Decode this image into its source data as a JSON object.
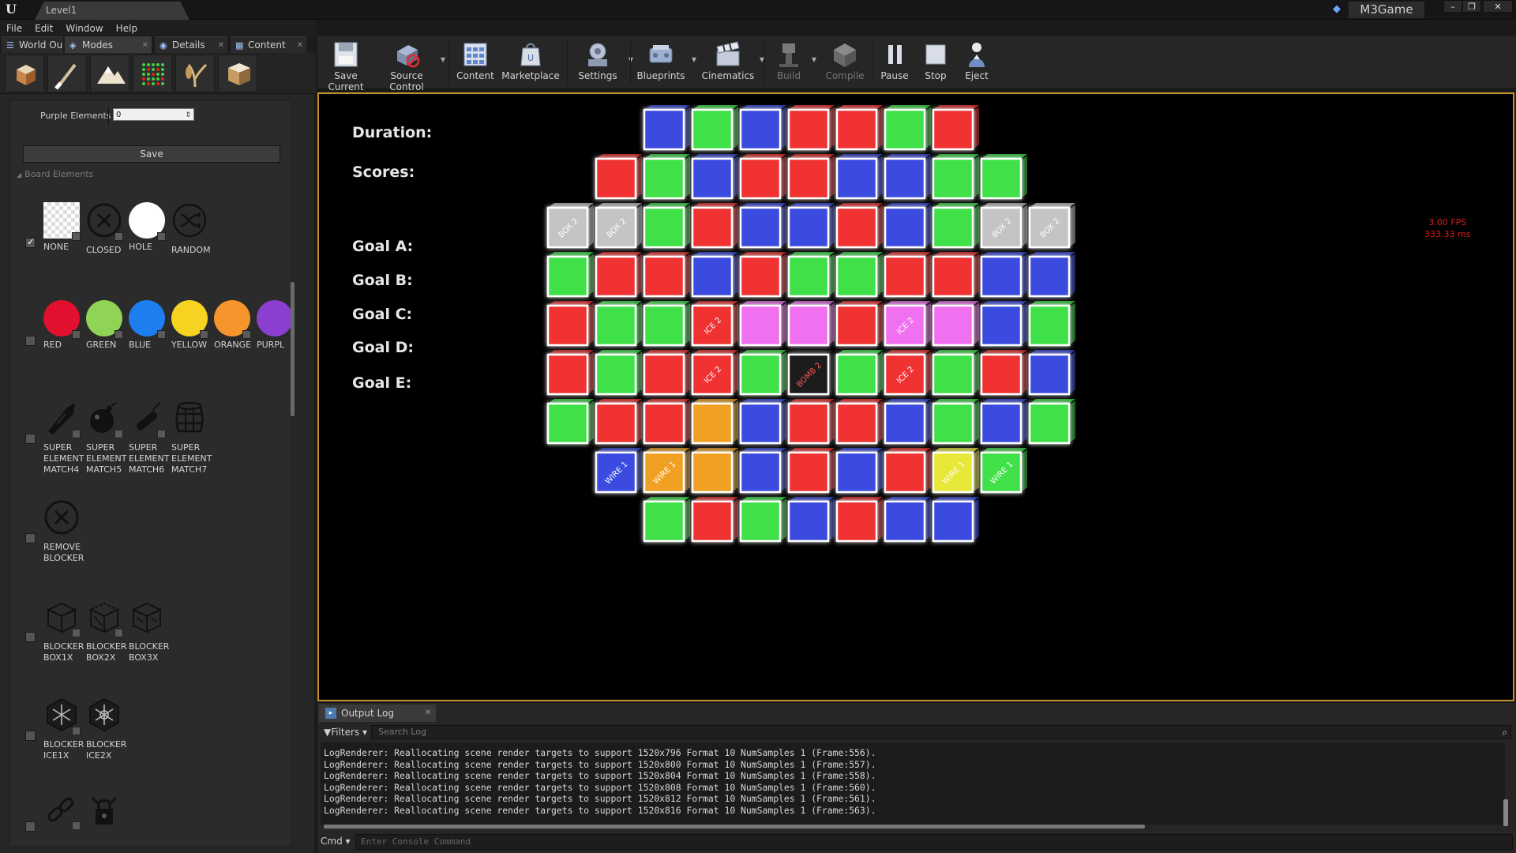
{
  "window": {
    "level_tab": "Level1",
    "app_name": "M3Game"
  },
  "menu": [
    "File",
    "Edit",
    "Window",
    "Help"
  ],
  "panel_tabs": [
    {
      "label": "World Ou"
    },
    {
      "label": "Modes"
    },
    {
      "label": "Details"
    },
    {
      "label": "Content"
    }
  ],
  "mode_tools": [
    "place-icon",
    "paint-icon",
    "landscape-icon",
    "foliage-icon",
    "mesh-paint-icon",
    "geometry-icon"
  ],
  "panel": {
    "purple_label": "Purple Elements",
    "purple_value": "0",
    "save_label": "Save",
    "section_title": "Board Elements",
    "row1": [
      {
        "label": "NONE"
      },
      {
        "label": "CLOSED"
      },
      {
        "label": "HOLE"
      },
      {
        "label": "RANDOM"
      }
    ],
    "row2": [
      {
        "label": "RED",
        "color": "#e0102e"
      },
      {
        "label": "GREEN",
        "color": "#8fd455"
      },
      {
        "label": "BLUE",
        "color": "#1e7ef0"
      },
      {
        "label": "YELLOW",
        "color": "#f5d320"
      },
      {
        "label": "ORANGE",
        "color": "#f5952c"
      },
      {
        "label": "PURPL",
        "color": "#8a3fd0"
      }
    ],
    "row3": [
      {
        "label": "SUPER ELEMENT MATCH4"
      },
      {
        "label": "SUPER ELEMENT MATCH5"
      },
      {
        "label": "SUPER ELEMENT MATCH6"
      },
      {
        "label": "SUPER ELEMENT MATCH7"
      }
    ],
    "row4": [
      {
        "label": "REMOVE BLOCKER"
      }
    ],
    "row5": [
      {
        "label": "BLOCKER BOX1X"
      },
      {
        "label": "BLOCKER BOX2X"
      },
      {
        "label": "BLOCKER BOX3X"
      }
    ],
    "row6": [
      {
        "label": "BLOCKER ICE1X"
      },
      {
        "label": "BLOCKER ICE2X"
      }
    ]
  },
  "toolbar": [
    {
      "label": "Save Current",
      "icon": "save-icon"
    },
    {
      "label": "Source Control",
      "icon": "source-control-icon"
    },
    {
      "label": "Content",
      "icon": "content-icon"
    },
    {
      "label": "Marketplace",
      "icon": "marketplace-icon"
    },
    {
      "label": "Settings",
      "icon": "settings-icon"
    },
    {
      "label": "Blueprints",
      "icon": "blueprints-icon"
    },
    {
      "label": "Cinematics",
      "icon": "cinematics-icon"
    },
    {
      "label": "Build",
      "icon": "build-icon"
    },
    {
      "label": "Compile",
      "icon": "compile-icon"
    },
    {
      "label": "Pause",
      "icon": "pause-icon"
    },
    {
      "label": "Stop",
      "icon": "stop-icon"
    },
    {
      "label": "Eject",
      "icon": "eject-icon"
    }
  ],
  "hud": {
    "duration": "Duration:",
    "scores": "Scores:",
    "goal_a": "Goal A:",
    "goal_b": "Goal B:",
    "goal_c": "Goal C:",
    "goal_d": "Goal D:",
    "goal_e": "Goal E:",
    "fps": "3.00 FPS",
    "ms": "333.33 ms"
  },
  "colors": {
    "R": "#f03232",
    "G": "#3fe04a",
    "B": "#3a4be0",
    "P": "#f070f0",
    "O": "#f0a020",
    "Y": "#e8e838",
    "X": "#c4c4c4",
    "K": "#1a1a1a"
  },
  "board": {
    "row_starts": [
      2,
      1,
      0,
      0,
      0,
      0,
      0,
      1,
      2
    ],
    "rows": [
      [
        {
          "c": "B"
        },
        {
          "c": "G"
        },
        {
          "c": "B"
        },
        {
          "c": "R"
        },
        {
          "c": "R"
        },
        {
          "c": "G"
        },
        {
          "c": "R"
        }
      ],
      [
        {
          "c": "R"
        },
        {
          "c": "G"
        },
        {
          "c": "B"
        },
        {
          "c": "R"
        },
        {
          "c": "R"
        },
        {
          "c": "B"
        },
        {
          "c": "B"
        },
        {
          "c": "G"
        },
        {
          "c": "G"
        }
      ],
      [
        {
          "c": "X",
          "t": "BOX 2"
        },
        {
          "c": "X",
          "t": "BOX 2"
        },
        {
          "c": "G"
        },
        {
          "c": "R"
        },
        {
          "c": "B"
        },
        {
          "c": "B"
        },
        {
          "c": "R"
        },
        {
          "c": "B"
        },
        {
          "c": "G"
        },
        {
          "c": "X",
          "t": "BOX 2"
        },
        {
          "c": "X",
          "t": "BOX 2"
        }
      ],
      [
        {
          "c": "G"
        },
        {
          "c": "R"
        },
        {
          "c": "R"
        },
        {
          "c": "B"
        },
        {
          "c": "R"
        },
        {
          "c": "G"
        },
        {
          "c": "G"
        },
        {
          "c": "R"
        },
        {
          "c": "R"
        },
        {
          "c": "B"
        },
        {
          "c": "B"
        }
      ],
      [
        {
          "c": "R"
        },
        {
          "c": "G"
        },
        {
          "c": "G"
        },
        {
          "c": "R",
          "t": "ICE 2"
        },
        {
          "c": "P"
        },
        {
          "c": "P"
        },
        {
          "c": "R"
        },
        {
          "c": "P",
          "t": "ICE 2"
        },
        {
          "c": "P"
        },
        {
          "c": "B"
        },
        {
          "c": "G"
        }
      ],
      [
        {
          "c": "R"
        },
        {
          "c": "G"
        },
        {
          "c": "R"
        },
        {
          "c": "R",
          "t": "ICE 2"
        },
        {
          "c": "G"
        },
        {
          "c": "K",
          "t": "BOMB 2"
        },
        {
          "c": "G"
        },
        {
          "c": "R",
          "t": "ICE 2"
        },
        {
          "c": "G"
        },
        {
          "c": "R"
        },
        {
          "c": "B"
        }
      ],
      [
        {
          "c": "G"
        },
        {
          "c": "R"
        },
        {
          "c": "R"
        },
        {
          "c": "O"
        },
        {
          "c": "B"
        },
        {
          "c": "R"
        },
        {
          "c": "R"
        },
        {
          "c": "B"
        },
        {
          "c": "G"
        },
        {
          "c": "B"
        },
        {
          "c": "G"
        }
      ],
      [
        {
          "c": "B",
          "t": "WIRE 1"
        },
        {
          "c": "O",
          "t": "WIRE 1"
        },
        {
          "c": "O"
        },
        {
          "c": "B"
        },
        {
          "c": "R"
        },
        {
          "c": "B"
        },
        {
          "c": "R"
        },
        {
          "c": "Y",
          "t": "WIRE 1"
        },
        {
          "c": "G",
          "t": "WIRE 1"
        }
      ],
      [
        {
          "c": "G"
        },
        {
          "c": "R"
        },
        {
          "c": "G"
        },
        {
          "c": "B"
        },
        {
          "c": "R"
        },
        {
          "c": "B"
        },
        {
          "c": "B"
        }
      ]
    ]
  },
  "log": {
    "tab": "Output Log",
    "filters": "Filters",
    "search_placeholder": "Search Log",
    "lines": [
      "LogRenderer: Reallocating scene render targets to support 1520x796 Format 10 NumSamples 1 (Frame:556).",
      "LogRenderer: Reallocating scene render targets to support 1520x800 Format 10 NumSamples 1 (Frame:557).",
      "LogRenderer: Reallocating scene render targets to support 1520x804 Format 10 NumSamples 1 (Frame:558).",
      "LogRenderer: Reallocating scene render targets to support 1520x808 Format 10 NumSamples 1 (Frame:560).",
      "LogRenderer: Reallocating scene render targets to support 1520x812 Format 10 NumSamples 1 (Frame:561).",
      "LogRenderer: Reallocating scene render targets to support 1520x816 Format 10 NumSamples 1 (Frame:563)."
    ],
    "cmd": "Cmd",
    "cmd_placeholder": "Enter Console Command"
  }
}
